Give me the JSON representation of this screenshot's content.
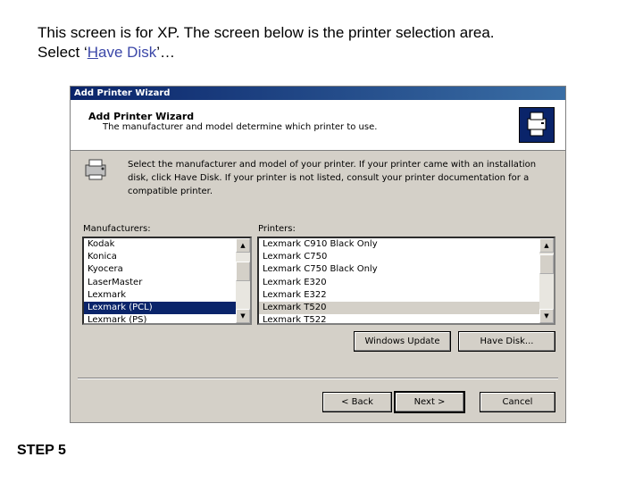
{
  "caption": {
    "line1": "This screen is for XP. The screen below is the printer selection area.",
    "line2_prefix": "Select ‘",
    "line2_key": "H",
    "line2_rest": "ave Disk",
    "line2_suffix": "’…"
  },
  "step_label": "STEP 5",
  "dialog": {
    "title": "Add Printer Wizard",
    "header_title": "Add Printer Wizard",
    "header_subtitle": "The manufacturer and model determine which printer to use.",
    "instructions": "Select the manufacturer and model of your printer. If your printer came with an installation disk, click Have Disk. If your printer is not listed, consult your printer documentation for a compatible printer.",
    "manufacturers_label": "Manufacturers:",
    "manufacturers": [
      "Kodak",
      "Konica",
      "Kyocera",
      "LaserMaster",
      "Lexmark",
      "Lexmark (PCL)",
      "Lexmark (PS)"
    ],
    "manufacturers_selected": "Lexmark (PCL)",
    "printers_label": "Printers:",
    "printers": [
      "Lexmark C910 Black Only",
      "Lexmark C750",
      "Lexmark C750 Black Only",
      "Lexmark E320",
      "Lexmark E322",
      "Lexmark T520",
      "Lexmark T522"
    ],
    "printers_selected": "Lexmark T520",
    "windows_update_label": "Windows Update",
    "have_disk_label": "Have Disk...",
    "back_label": "< Back",
    "next_label": "Next >",
    "cancel_label": "Cancel"
  },
  "colors": {
    "title_bar": "#0a246a",
    "dialog_bg": "#d4d0c8",
    "caption_highlight": "#3b47a8"
  }
}
